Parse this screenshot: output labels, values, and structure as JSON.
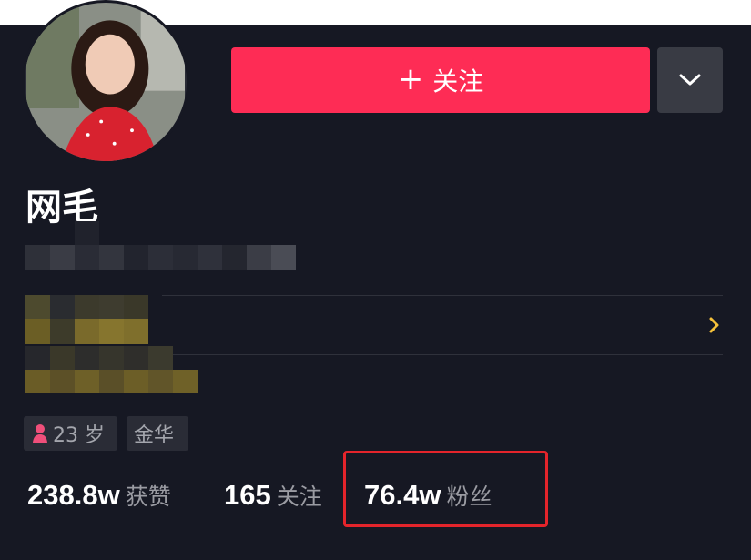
{
  "profile": {
    "name": "网毛",
    "follow_button": {
      "icon": "plus-icon",
      "label": "关注"
    },
    "more_button": {
      "icon": "chevron-down-icon"
    },
    "tags": [
      {
        "icon": "female-person-icon",
        "icon_color": "#f04f7a",
        "label": "23 岁"
      },
      {
        "label": "金华"
      }
    ],
    "stats": [
      {
        "value": "238.8w",
        "label": "获赞"
      },
      {
        "value": "165",
        "label": "关注"
      },
      {
        "value": "76.4w",
        "label": "粉丝"
      }
    ],
    "highlighted_stat": "粉丝"
  },
  "colors": {
    "background": "#161823",
    "accent": "#fe2c55",
    "chevron": "#f5c13a",
    "highlight_border": "#e4242b"
  }
}
